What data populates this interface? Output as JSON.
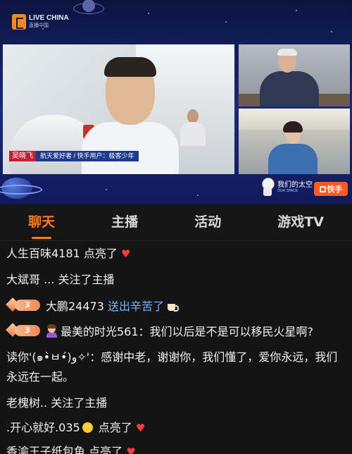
{
  "stream": {
    "logo_text": "LIVE CHINA",
    "logo_sub": "直播中国",
    "host_name": "吴晓飞",
    "host_desc": "航天爱好者 / 快手用户：极客少年",
    "badge_text": "我们的太空",
    "badge_sub": "OUR SPACE",
    "kuaishou_label": "快手"
  },
  "tabs": [
    {
      "label": "聊天",
      "active": true
    },
    {
      "label": "主播",
      "active": false
    },
    {
      "label": "活动",
      "active": false
    },
    {
      "label": "游戏TV",
      "active": false
    }
  ],
  "chat": [
    {
      "user": "人生百味4181",
      "text": " 点亮了"
    },
    {
      "user": "大斌哥",
      "text": " ... 关注了主播"
    },
    {
      "level": "3",
      "user": "大鹏24473",
      "gift": " 送出辛苦了"
    },
    {
      "level": "3",
      "user": "最美的时光561",
      "text": "：我们以后是不是可以移民火星啊?"
    },
    {
      "user": "读你'(๑•̀ㅂ•́)و✧'",
      "text": "：感谢中老，谢谢你，我们懂了，爱你永远，我们永远在一起。"
    },
    {
      "user": "老槐树..",
      "text": " 关注了主播"
    },
    {
      "user": ".开心就好.035",
      "text": " 点亮了"
    },
    {
      "user": "香渝王子纸包鱼",
      "text": " 点亮了"
    }
  ],
  "colors": {
    "accent": "#ff7a1a",
    "heart": "#ff3b3b",
    "gift_text": "#6fb6ff",
    "chat_bg": "#141414"
  }
}
